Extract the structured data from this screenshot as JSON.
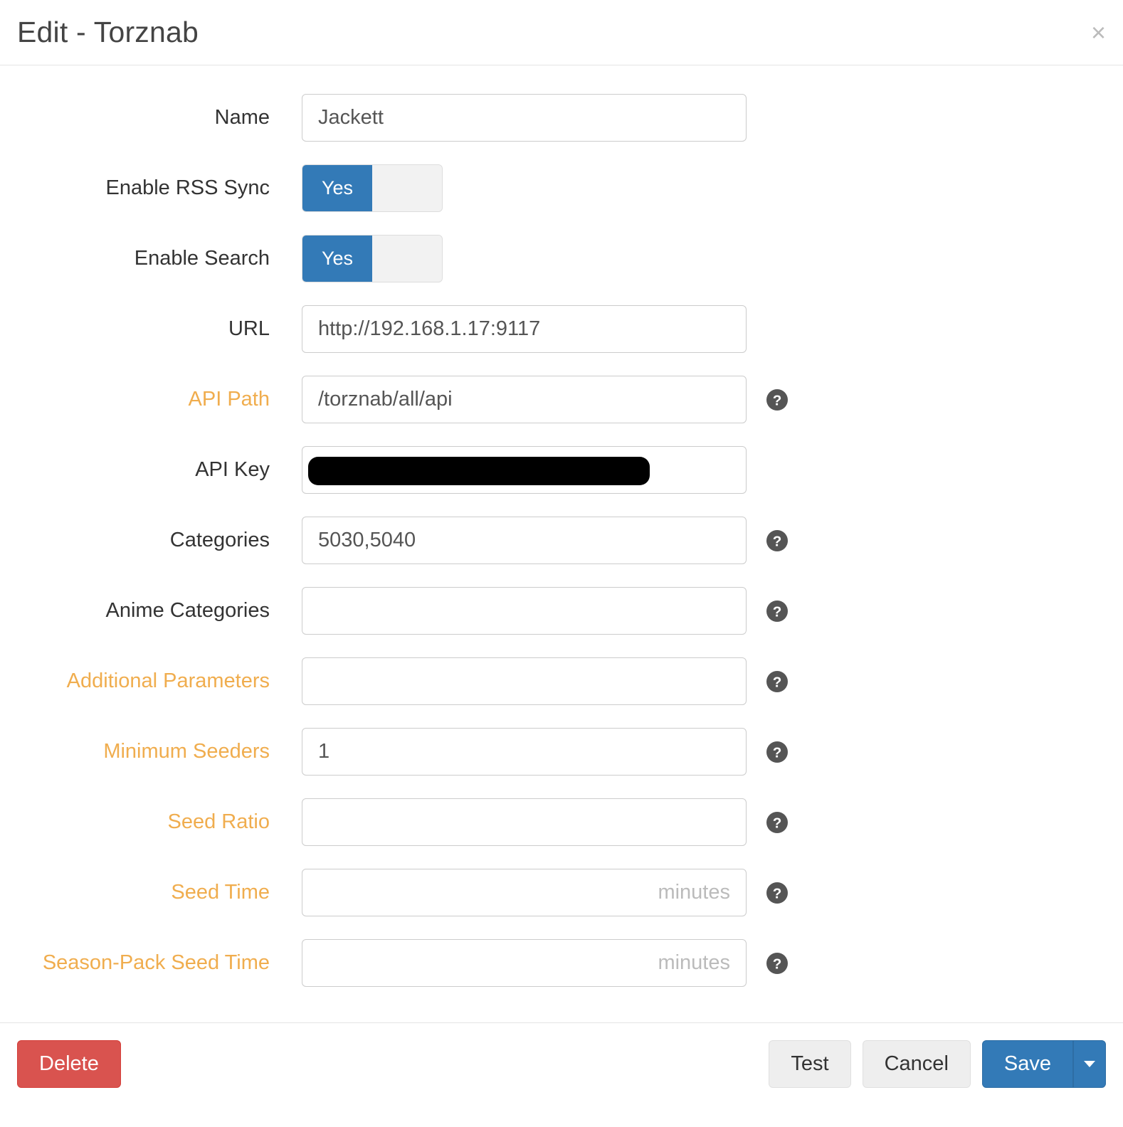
{
  "modal": {
    "title": "Edit - Torznab"
  },
  "toggle_labels": {
    "yes": "Yes"
  },
  "form": {
    "name": {
      "label": "Name",
      "value": "Jackett"
    },
    "rss": {
      "label": "Enable RSS Sync"
    },
    "search": {
      "label": "Enable Search"
    },
    "url": {
      "label": "URL",
      "value": "http://192.168.1.17:9117"
    },
    "api_path": {
      "label": "API Path",
      "value": "/torznab/all/api"
    },
    "api_key": {
      "label": "API Key",
      "value": ""
    },
    "categories": {
      "label": "Categories",
      "value": "5030,5040"
    },
    "anime_cat": {
      "label": "Anime Categories",
      "value": ""
    },
    "add_params": {
      "label": "Additional Parameters",
      "value": ""
    },
    "min_seeders": {
      "label": "Minimum Seeders",
      "value": "1"
    },
    "seed_ratio": {
      "label": "Seed Ratio",
      "value": ""
    },
    "seed_time": {
      "label": "Seed Time",
      "value": "",
      "placeholder": "minutes"
    },
    "season_seed": {
      "label": "Season-Pack Seed Time",
      "value": "",
      "placeholder": "minutes"
    }
  },
  "footer": {
    "delete": "Delete",
    "test": "Test",
    "cancel": "Cancel",
    "save": "Save"
  }
}
